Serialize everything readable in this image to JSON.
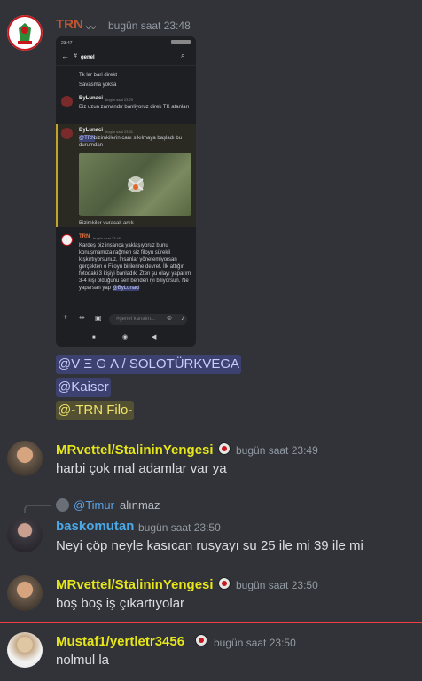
{
  "messages": [
    {
      "username": "TRN",
      "timestamp": "bugün saat 23:48",
      "name_color": "#c0562f",
      "phone": {
        "status_time": "23:47",
        "channel": "genel",
        "lines_top": [
          "Tk lar bari direkt",
          "Savasma yoksa"
        ],
        "bylunaci_1": {
          "name": "ByLunaci",
          "time": "bugün saat 23:29",
          "text": "Biz uzun zamandır banliyoruz direk TK atanları"
        },
        "bylunaci_2": {
          "name": "ByLunaci",
          "time": "bugün saat 23:31",
          "mention": "@TRN",
          "text": "bizimkilerin canı sıkılmaya başladı bu durumdan"
        },
        "caption": "Bizimkiler vuracak artık",
        "trn": {
          "name": "TRN",
          "time": "bugün saat 23:46",
          "text": "Kardeş biz insanca yaklaşıyoruz bunu konuşmamıza rağmen siz filoyu sürekli kışkırtıyorsunuz. İnsanlar yönetemiyorsan gerçekten o Filoyu birilerine devret. İlk attığın fotodaki 3 kişiyi banladık. Zten şu olayı yaparım 3-4 kişi olduğunu sen benden iyi biliyorsun. Ne yaparsan yap",
          "mention": "@ByLunaci"
        },
        "input_placeholder": "#genel kanalın..."
      },
      "mentions": [
        "@V Ξ G Λ / SOLOTÜRKVEGA",
        "@Kaiser",
        "@-TRN Filo-"
      ]
    },
    {
      "username": "MRvettel/StalininYengesi",
      "timestamp": "bugün saat 23:49",
      "name_color": "#e6e61a",
      "text": "harbi çok mal adamlar var ya"
    },
    {
      "reply_to": "@Timur",
      "reply_text": "alınmaz",
      "username": "baskomutan",
      "timestamp": "bugün saat 23:50",
      "name_color": "#4aa8e6",
      "text": "Neyi çöp neyle kasıcan rusyayı su 25 ile mi 39 ile mi"
    },
    {
      "username": "MRvettel/StalininYengesi",
      "timestamp": "bugün saat 23:50",
      "name_color": "#e6e61a",
      "text": "boş boş iş çıkartıyolar"
    },
    {
      "username": "Mustaf1/yertletr3456",
      "timestamp": "bugün saat 23:50",
      "name_color": "#e6e61a",
      "text": "nolmul la"
    }
  ]
}
